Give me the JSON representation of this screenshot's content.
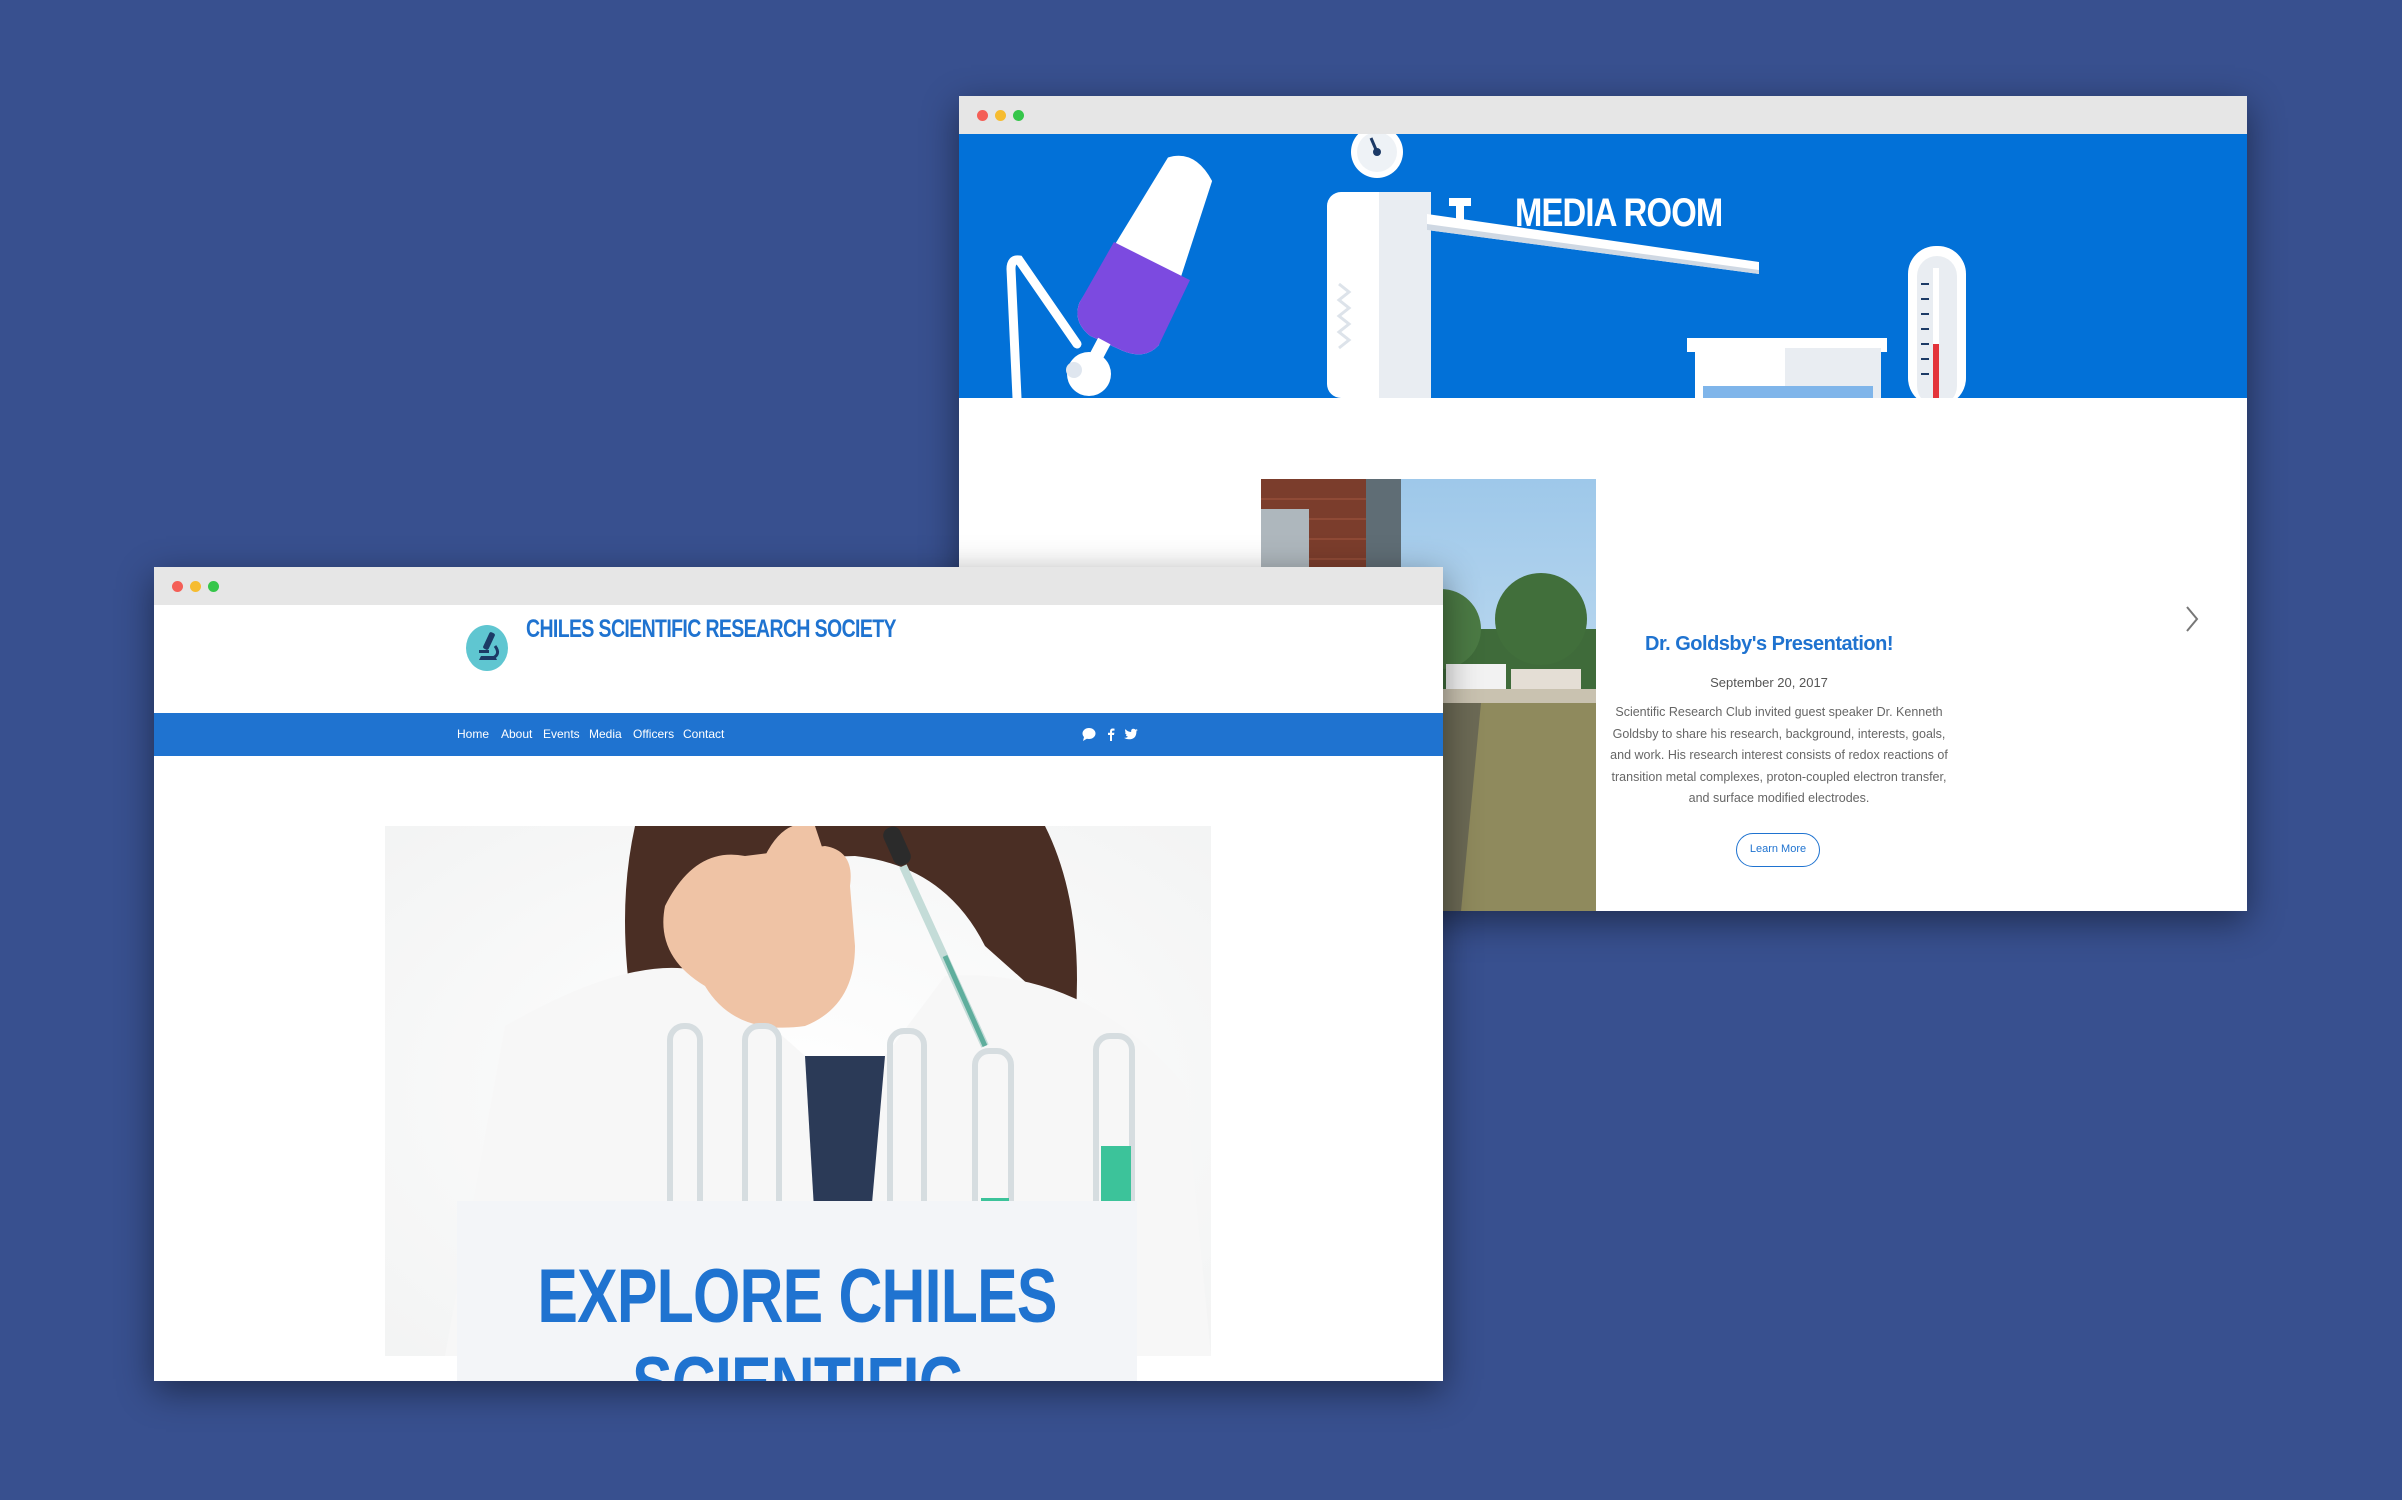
{
  "media_window": {
    "hero_title": "MEDIA ROOM",
    "post": {
      "title": "Dr. Goldsby's Presentation!",
      "date": "September 20, 2017",
      "text": "Scientific Research Club invited guest speaker Dr. Kenneth Goldsby to share his research, background, interests, goals, and work. His research interest consists of redox reactions of transition metal complexes, proton-coupled electron transfer, and surface modified electrodes.",
      "button": "Learn More"
    }
  },
  "home_window": {
    "site_name": "CHILES SCIENTIFIC RESEARCH SOCIETY",
    "nav": [
      "Home",
      "About",
      "Events",
      "Media",
      "Officers",
      "Contact"
    ],
    "social_icons": [
      "chat-icon",
      "facebook-icon",
      "twitter-icon"
    ],
    "hero_heading": "EXPLORE CHILES\nSCIENTIFIC RESEARCH"
  },
  "colors": {
    "background": "#38508f",
    "brand_blue": "#1f73d0",
    "hero_blue": "#0271d8",
    "flask_liquid": "#7c4ae0"
  }
}
